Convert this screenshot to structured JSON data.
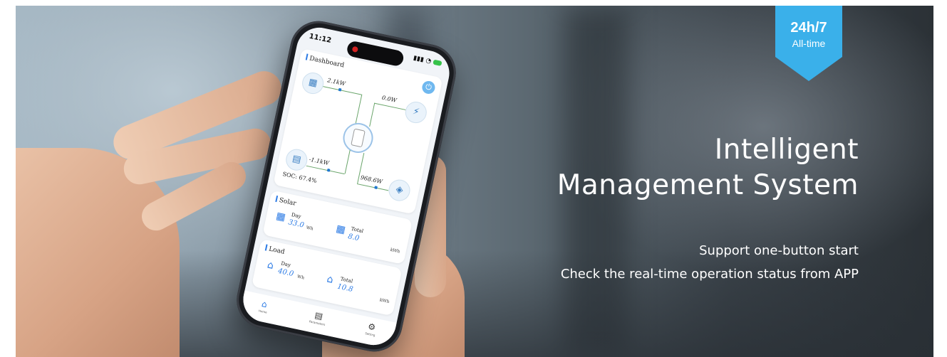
{
  "badge": {
    "main": "24h/7",
    "sub": "All-time",
    "color": "#3ab0ea"
  },
  "headline": {
    "line1": "Intelligent",
    "line2": "Management System"
  },
  "subtext": {
    "line1": "Support one-button start",
    "line2": "Check the real-time operation status from APP"
  },
  "phone": {
    "status_time": "11:12",
    "dashboard": {
      "title": "Dashboard",
      "solar_power": "2.1kW",
      "grid_power": "0.0W",
      "battery_power": "-1.1kW",
      "load_power": "968.6W",
      "soc": "SOC: 67.4%"
    },
    "solar": {
      "title": "Solar",
      "day_label": "Day",
      "day_value": "33.0",
      "day_unit": "Wh",
      "total_label": "Total",
      "total_value": "8.0",
      "total_unit": "kWh"
    },
    "load": {
      "title": "Load",
      "day_label": "Day",
      "day_value": "40.0",
      "day_unit": "Wh",
      "total_label": "Total",
      "total_value": "10.8",
      "total_unit": "kWh"
    },
    "tabs": [
      {
        "label": "Home",
        "icon": "home-icon"
      },
      {
        "label": "Parameters",
        "icon": "parameters-icon"
      },
      {
        "label": "Setting",
        "icon": "gear-icon"
      }
    ]
  },
  "colors": {
    "accent": "#2c7be5",
    "flow_line": "#6aa56b"
  }
}
